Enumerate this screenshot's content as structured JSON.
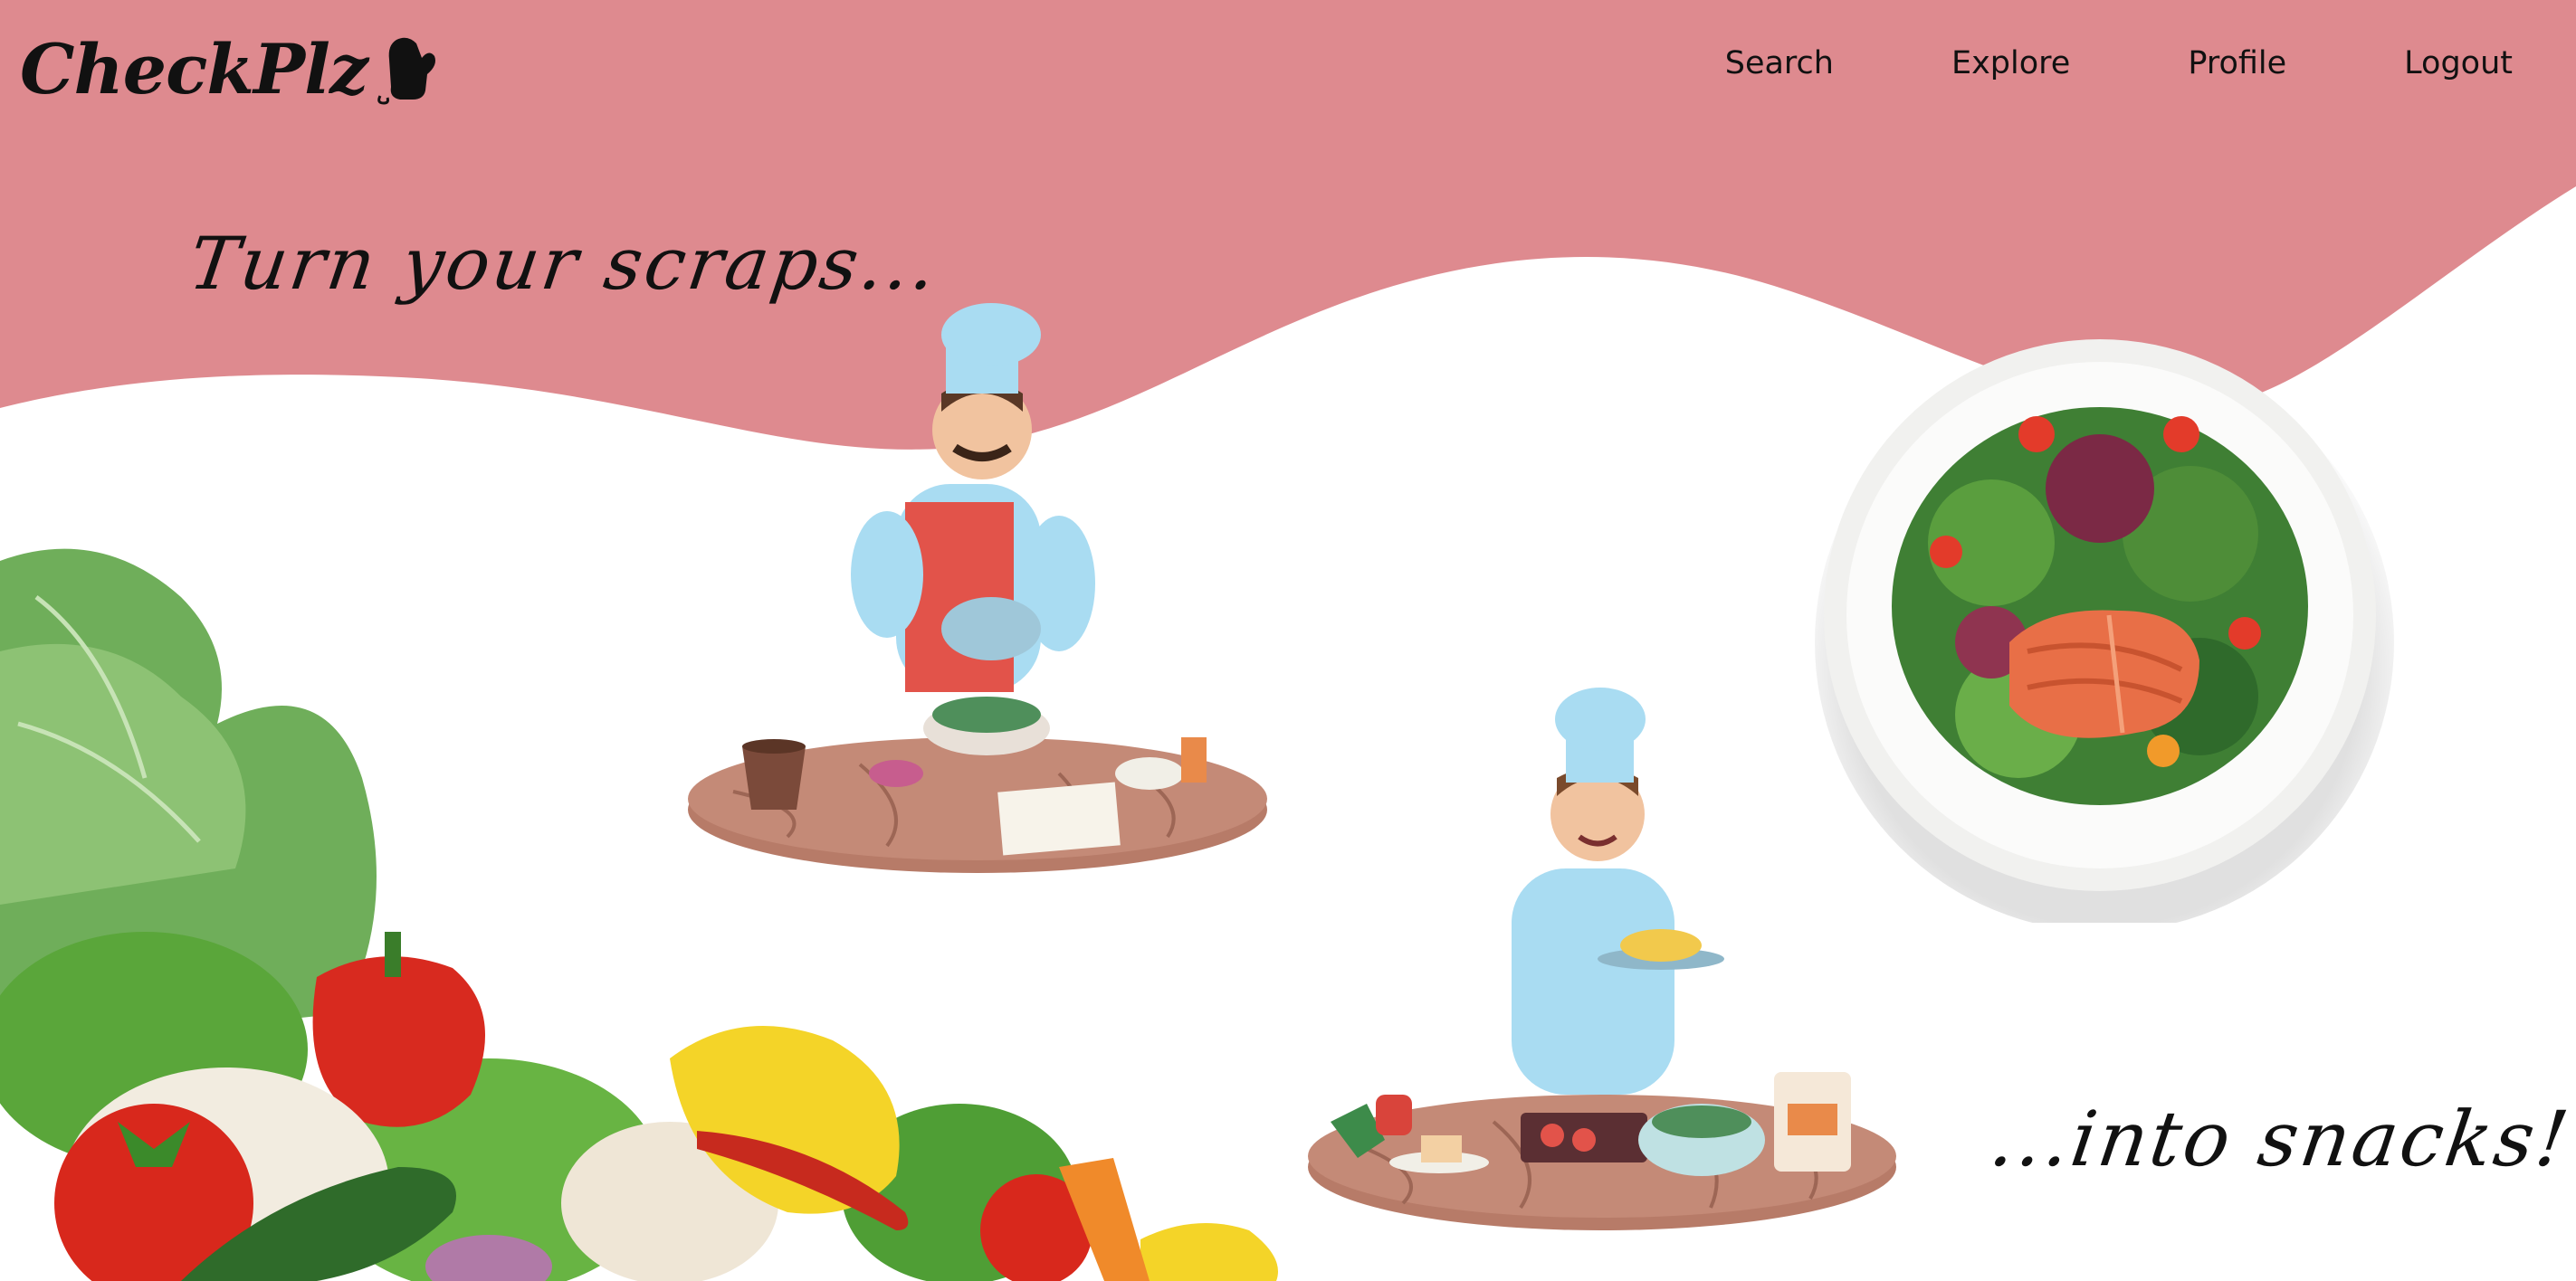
{
  "brand": {
    "logo_text": "CheckPlz",
    "logo_icon": "oven-mitt-icon"
  },
  "nav": {
    "links": [
      {
        "label": "Search"
      },
      {
        "label": "Explore"
      },
      {
        "label": "Profile"
      },
      {
        "label": "Logout"
      }
    ]
  },
  "hero": {
    "tagline_start": "Turn your scraps...",
    "tagline_end": "...into snacks!"
  },
  "colors": {
    "brand_pink": "#de8a8f",
    "text": "#111111"
  },
  "images": {
    "chef_mixing": "chef-mixing-illustration",
    "chef_serving": "chef-serving-illustration",
    "salmon_plate": "salmon-salad-plate-photo",
    "vegetables": "vegetables-pile-photo"
  }
}
